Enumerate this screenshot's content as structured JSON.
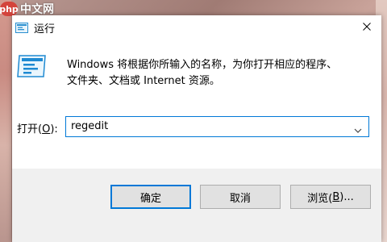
{
  "watermark": {
    "logo": "php",
    "text": "中文网"
  },
  "window": {
    "title": "运行",
    "close_icon": "close-icon"
  },
  "content": {
    "description_line1": "Windows 将根据你所输入的名称，为你打开相应的程序、",
    "description_line2": "文件夹、文档或 Internet 资源。",
    "open_label_prefix": "打开(",
    "open_label_key": "O",
    "open_label_suffix": "):",
    "input_value": "regedit"
  },
  "buttons": {
    "ok": "确定",
    "cancel": "取消",
    "browse_prefix": "浏览(",
    "browse_key": "B",
    "browse_suffix": ")..."
  },
  "colors": {
    "accent": "#0078d7",
    "footer_bg": "#f0f0f0",
    "button_bg": "#e1e1e1"
  }
}
